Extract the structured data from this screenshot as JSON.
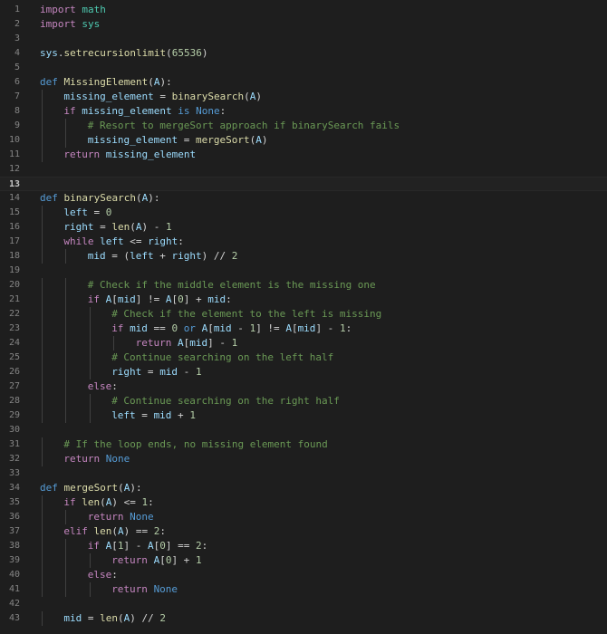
{
  "editor": {
    "language": "python",
    "colors": {
      "background": "#1e1e1e",
      "line_number": "#858585",
      "keyword": "#569cd6",
      "control": "#c586c0",
      "function": "#dcdcaa",
      "variable": "#9cdcfe",
      "number": "#b5cea8",
      "comment": "#6a9955"
    },
    "current_line": 13,
    "lines": [
      {
        "n": "1",
        "indent": 0,
        "tokens": [
          [
            "ctl",
            "import"
          ],
          [
            "op",
            " "
          ],
          [
            "cls",
            "math"
          ]
        ]
      },
      {
        "n": "2",
        "indent": 0,
        "tokens": [
          [
            "ctl",
            "import"
          ],
          [
            "op",
            " "
          ],
          [
            "cls",
            "sys"
          ]
        ]
      },
      {
        "n": "3",
        "indent": 0,
        "tokens": []
      },
      {
        "n": "4",
        "indent": 0,
        "tokens": [
          [
            "var",
            "sys"
          ],
          [
            "op",
            "."
          ],
          [
            "fn",
            "setrecursionlimit"
          ],
          [
            "op",
            "("
          ],
          [
            "num",
            "65536"
          ],
          [
            "op",
            ")"
          ]
        ]
      },
      {
        "n": "5",
        "indent": 0,
        "tokens": []
      },
      {
        "n": "6",
        "indent": 0,
        "tokens": [
          [
            "kw",
            "def"
          ],
          [
            "op",
            " "
          ],
          [
            "fn",
            "MissingElement"
          ],
          [
            "op",
            "("
          ],
          [
            "var",
            "A"
          ],
          [
            "op",
            "):"
          ]
        ]
      },
      {
        "n": "7",
        "indent": 1,
        "tokens": [
          [
            "var",
            "missing_element"
          ],
          [
            "op",
            " = "
          ],
          [
            "fn",
            "binarySearch"
          ],
          [
            "op",
            "("
          ],
          [
            "var",
            "A"
          ],
          [
            "op",
            ")"
          ]
        ]
      },
      {
        "n": "8",
        "indent": 1,
        "tokens": [
          [
            "ctl",
            "if"
          ],
          [
            "op",
            " "
          ],
          [
            "var",
            "missing_element"
          ],
          [
            "op",
            " "
          ],
          [
            "kw",
            "is"
          ],
          [
            "op",
            " "
          ],
          [
            "kw",
            "None"
          ],
          [
            "op",
            ":"
          ]
        ]
      },
      {
        "n": "9",
        "indent": 2,
        "tokens": [
          [
            "cm",
            "# Resort to mergeSort approach if binarySearch fails"
          ]
        ]
      },
      {
        "n": "10",
        "indent": 2,
        "tokens": [
          [
            "var",
            "missing_element"
          ],
          [
            "op",
            " = "
          ],
          [
            "fn",
            "mergeSort"
          ],
          [
            "op",
            "("
          ],
          [
            "var",
            "A"
          ],
          [
            "op",
            ")"
          ]
        ]
      },
      {
        "n": "11",
        "indent": 1,
        "tokens": [
          [
            "ctl",
            "return"
          ],
          [
            "op",
            " "
          ],
          [
            "var",
            "missing_element"
          ]
        ]
      },
      {
        "n": "12",
        "indent": 0,
        "tokens": []
      },
      {
        "n": "13",
        "indent": 0,
        "tokens": []
      },
      {
        "n": "14",
        "indent": 0,
        "tokens": [
          [
            "kw",
            "def"
          ],
          [
            "op",
            " "
          ],
          [
            "fn",
            "binarySearch"
          ],
          [
            "op",
            "("
          ],
          [
            "var",
            "A"
          ],
          [
            "op",
            "):"
          ]
        ]
      },
      {
        "n": "15",
        "indent": 1,
        "tokens": [
          [
            "var",
            "left"
          ],
          [
            "op",
            " = "
          ],
          [
            "num",
            "0"
          ]
        ]
      },
      {
        "n": "16",
        "indent": 1,
        "tokens": [
          [
            "var",
            "right"
          ],
          [
            "op",
            " = "
          ],
          [
            "fn",
            "len"
          ],
          [
            "op",
            "("
          ],
          [
            "var",
            "A"
          ],
          [
            "op",
            ") - "
          ],
          [
            "num",
            "1"
          ]
        ]
      },
      {
        "n": "17",
        "indent": 1,
        "tokens": [
          [
            "ctl",
            "while"
          ],
          [
            "op",
            " "
          ],
          [
            "var",
            "left"
          ],
          [
            "op",
            " <= "
          ],
          [
            "var",
            "right"
          ],
          [
            "op",
            ":"
          ]
        ]
      },
      {
        "n": "18",
        "indent": 2,
        "tokens": [
          [
            "var",
            "mid"
          ],
          [
            "op",
            " = ("
          ],
          [
            "var",
            "left"
          ],
          [
            "op",
            " + "
          ],
          [
            "var",
            "right"
          ],
          [
            "op",
            ") // "
          ],
          [
            "num",
            "2"
          ]
        ]
      },
      {
        "n": "19",
        "indent": 0,
        "tokens": []
      },
      {
        "n": "20",
        "indent": 2,
        "tokens": [
          [
            "cm",
            "# Check if the middle element is the missing one"
          ]
        ]
      },
      {
        "n": "21",
        "indent": 2,
        "tokens": [
          [
            "ctl",
            "if"
          ],
          [
            "op",
            " "
          ],
          [
            "var",
            "A"
          ],
          [
            "op",
            "["
          ],
          [
            "var",
            "mid"
          ],
          [
            "op",
            "] != "
          ],
          [
            "var",
            "A"
          ],
          [
            "op",
            "["
          ],
          [
            "num",
            "0"
          ],
          [
            "op",
            "] + "
          ],
          [
            "var",
            "mid"
          ],
          [
            "op",
            ":"
          ]
        ]
      },
      {
        "n": "22",
        "indent": 3,
        "tokens": [
          [
            "cm",
            "# Check if the element to the left is missing"
          ]
        ]
      },
      {
        "n": "23",
        "indent": 3,
        "tokens": [
          [
            "ctl",
            "if"
          ],
          [
            "op",
            " "
          ],
          [
            "var",
            "mid"
          ],
          [
            "op",
            " == "
          ],
          [
            "num",
            "0"
          ],
          [
            "op",
            " "
          ],
          [
            "kw",
            "or"
          ],
          [
            "op",
            " "
          ],
          [
            "var",
            "A"
          ],
          [
            "op",
            "["
          ],
          [
            "var",
            "mid"
          ],
          [
            "op",
            " - "
          ],
          [
            "num",
            "1"
          ],
          [
            "op",
            "] != "
          ],
          [
            "var",
            "A"
          ],
          [
            "op",
            "["
          ],
          [
            "var",
            "mid"
          ],
          [
            "op",
            "] - "
          ],
          [
            "num",
            "1"
          ],
          [
            "op",
            ":"
          ]
        ]
      },
      {
        "n": "24",
        "indent": 4,
        "tokens": [
          [
            "ctl",
            "return"
          ],
          [
            "op",
            " "
          ],
          [
            "var",
            "A"
          ],
          [
            "op",
            "["
          ],
          [
            "var",
            "mid"
          ],
          [
            "op",
            "] - "
          ],
          [
            "num",
            "1"
          ]
        ]
      },
      {
        "n": "25",
        "indent": 3,
        "tokens": [
          [
            "cm",
            "# Continue searching on the left half"
          ]
        ]
      },
      {
        "n": "26",
        "indent": 3,
        "tokens": [
          [
            "var",
            "right"
          ],
          [
            "op",
            " = "
          ],
          [
            "var",
            "mid"
          ],
          [
            "op",
            " - "
          ],
          [
            "num",
            "1"
          ]
        ]
      },
      {
        "n": "27",
        "indent": 2,
        "tokens": [
          [
            "ctl",
            "else"
          ],
          [
            "op",
            ":"
          ]
        ]
      },
      {
        "n": "28",
        "indent": 3,
        "tokens": [
          [
            "cm",
            "# Continue searching on the right half"
          ]
        ]
      },
      {
        "n": "29",
        "indent": 3,
        "tokens": [
          [
            "var",
            "left"
          ],
          [
            "op",
            " = "
          ],
          [
            "var",
            "mid"
          ],
          [
            "op",
            " + "
          ],
          [
            "num",
            "1"
          ]
        ]
      },
      {
        "n": "30",
        "indent": 0,
        "tokens": []
      },
      {
        "n": "31",
        "indent": 1,
        "tokens": [
          [
            "cm",
            "# If the loop ends, no missing element found"
          ]
        ]
      },
      {
        "n": "32",
        "indent": 1,
        "tokens": [
          [
            "ctl",
            "return"
          ],
          [
            "op",
            " "
          ],
          [
            "kw",
            "None"
          ]
        ]
      },
      {
        "n": "33",
        "indent": 0,
        "tokens": []
      },
      {
        "n": "34",
        "indent": 0,
        "tokens": [
          [
            "kw",
            "def"
          ],
          [
            "op",
            " "
          ],
          [
            "fn",
            "mergeSort"
          ],
          [
            "op",
            "("
          ],
          [
            "var",
            "A"
          ],
          [
            "op",
            "):"
          ]
        ]
      },
      {
        "n": "35",
        "indent": 1,
        "tokens": [
          [
            "ctl",
            "if"
          ],
          [
            "op",
            " "
          ],
          [
            "fn",
            "len"
          ],
          [
            "op",
            "("
          ],
          [
            "var",
            "A"
          ],
          [
            "op",
            ") <= "
          ],
          [
            "num",
            "1"
          ],
          [
            "op",
            ":"
          ]
        ]
      },
      {
        "n": "36",
        "indent": 2,
        "tokens": [
          [
            "ctl",
            "return"
          ],
          [
            "op",
            " "
          ],
          [
            "kw",
            "None"
          ]
        ]
      },
      {
        "n": "37",
        "indent": 1,
        "tokens": [
          [
            "ctl",
            "elif"
          ],
          [
            "op",
            " "
          ],
          [
            "fn",
            "len"
          ],
          [
            "op",
            "("
          ],
          [
            "var",
            "A"
          ],
          [
            "op",
            ") == "
          ],
          [
            "num",
            "2"
          ],
          [
            "op",
            ":"
          ]
        ]
      },
      {
        "n": "38",
        "indent": 2,
        "tokens": [
          [
            "ctl",
            "if"
          ],
          [
            "op",
            " "
          ],
          [
            "var",
            "A"
          ],
          [
            "op",
            "["
          ],
          [
            "num",
            "1"
          ],
          [
            "op",
            "] - "
          ],
          [
            "var",
            "A"
          ],
          [
            "op",
            "["
          ],
          [
            "num",
            "0"
          ],
          [
            "op",
            "] == "
          ],
          [
            "num",
            "2"
          ],
          [
            "op",
            ":"
          ]
        ]
      },
      {
        "n": "39",
        "indent": 3,
        "tokens": [
          [
            "ctl",
            "return"
          ],
          [
            "op",
            " "
          ],
          [
            "var",
            "A"
          ],
          [
            "op",
            "["
          ],
          [
            "num",
            "0"
          ],
          [
            "op",
            "] + "
          ],
          [
            "num",
            "1"
          ]
        ]
      },
      {
        "n": "40",
        "indent": 2,
        "tokens": [
          [
            "ctl",
            "else"
          ],
          [
            "op",
            ":"
          ]
        ]
      },
      {
        "n": "41",
        "indent": 3,
        "tokens": [
          [
            "ctl",
            "return"
          ],
          [
            "op",
            " "
          ],
          [
            "kw",
            "None"
          ]
        ]
      },
      {
        "n": "42",
        "indent": 0,
        "tokens": []
      },
      {
        "n": "43",
        "indent": 1,
        "tokens": [
          [
            "var",
            "mid"
          ],
          [
            "op",
            " = "
          ],
          [
            "fn",
            "len"
          ],
          [
            "op",
            "("
          ],
          [
            "var",
            "A"
          ],
          [
            "op",
            ") // "
          ],
          [
            "num",
            "2"
          ]
        ]
      }
    ]
  }
}
